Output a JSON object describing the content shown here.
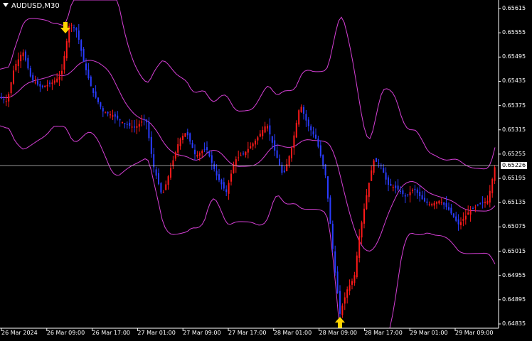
{
  "window": {
    "title": "AUDUSD,M30"
  },
  "price_axis": {
    "labels": [
      "0.65615",
      "0.65555",
      "0.65495",
      "0.65435",
      "0.65375",
      "0.65315",
      "0.65255",
      "0.65195",
      "0.65135",
      "0.65075",
      "0.65015",
      "0.64955",
      "0.64895",
      "0.64835"
    ],
    "current_price": "0.65226"
  },
  "time_axis": {
    "labels": [
      "26 Mar 2024",
      "26 Mar 09:00",
      "26 Mar 17:00",
      "27 Mar 01:00",
      "27 Mar 09:00",
      "27 Mar 17:00",
      "28 Mar 01:00",
      "28 Mar 09:00",
      "28 Mar 17:00",
      "29 Mar 01:00",
      "29 Mar 09:00"
    ]
  },
  "colors": {
    "background": "#000000",
    "bull_candle": "#ff1a1a",
    "bear_candle": "#2a3cff",
    "bands": "#d63fd6",
    "grid_line": "#ffffff",
    "arrow": "#ffd400"
  },
  "chart_data": {
    "type": "candlestick",
    "symbol": "AUDUSD",
    "timeframe": "M30",
    "ylim": [
      0.64825,
      0.6563
    ],
    "x_labels": [
      "26 Mar 2024",
      "26 Mar 09:00",
      "26 Mar 17:00",
      "27 Mar 01:00",
      "27 Mar 09:00",
      "27 Mar 17:00",
      "28 Mar 01:00",
      "28 Mar 09:00",
      "28 Mar 17:00",
      "29 Mar 01:00",
      "29 Mar 09:00"
    ],
    "current_price": 0.65226,
    "markers": [
      {
        "type": "sell-arrow",
        "near": "26 Mar 09:00",
        "price": 0.65575
      },
      {
        "type": "buy-arrow",
        "near": "28 Mar 09:00",
        "price": 0.64845
      }
    ],
    "indicators": [
      "Bollinger Bands"
    ]
  }
}
